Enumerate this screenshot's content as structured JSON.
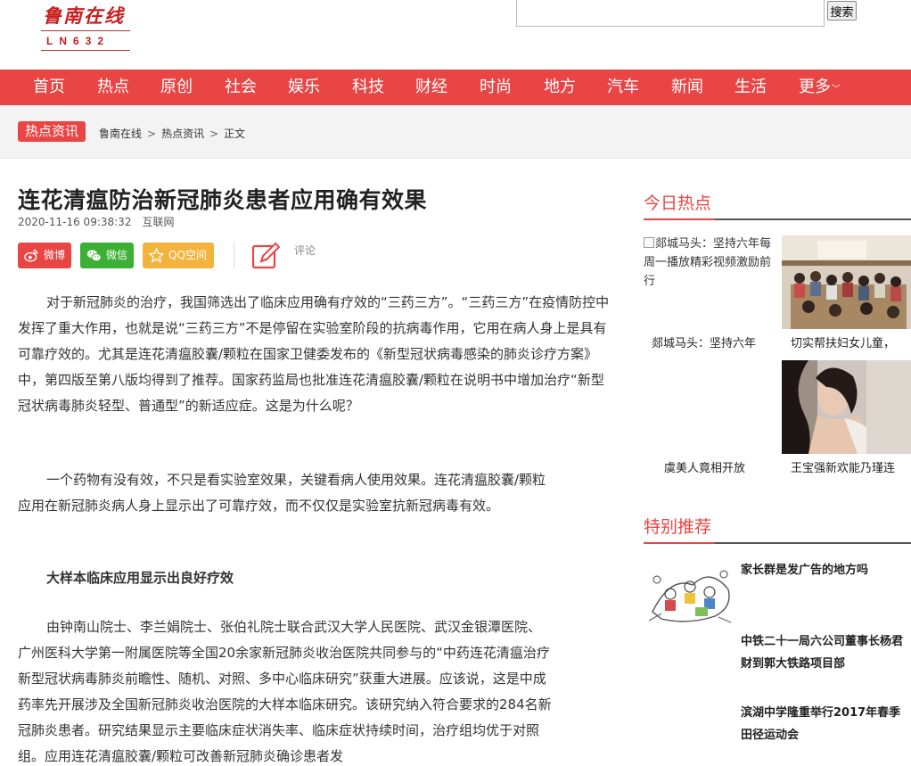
{
  "site": {
    "logo_cn": "鲁南在线",
    "logo_en": "LN632"
  },
  "search": {
    "value": "",
    "button_label": "搜索"
  },
  "nav": [
    {
      "label": "首页"
    },
    {
      "label": "热点"
    },
    {
      "label": "原创"
    },
    {
      "label": "社会"
    },
    {
      "label": "娱乐"
    },
    {
      "label": "科技"
    },
    {
      "label": "财经"
    },
    {
      "label": "时尚"
    },
    {
      "label": "地方"
    },
    {
      "label": "汽车"
    },
    {
      "label": "新闻"
    },
    {
      "label": "生活"
    },
    {
      "label": "更多"
    }
  ],
  "breadcrumb": {
    "badge": "热点资讯",
    "items": [
      "鲁南在线",
      "热点资讯",
      "正文"
    ],
    "sep": ">"
  },
  "article": {
    "title": "连花清瘟防治新冠肺炎患者应用确有效果",
    "date": "2020-11-16 09:38:32",
    "source": "互联网",
    "share": {
      "weibo": "微博",
      "wechat": "微信",
      "qzone": "QQ空间",
      "comment": "评论"
    },
    "colors": {
      "weibo": "#e94545",
      "wechat": "#3cb034",
      "qzone": "#f4b33d"
    },
    "paragraphs": [
      "对于新冠肺炎的治疗，我国筛选出了临床应用确有疗效的“三药三方”。“三药三方”在疫情防控中发挥了重大作用，也就是说“三药三方”不是停留在实验室阶段的抗病毒作用，它用在病人身上是具有可靠疗效的。尤其是连花清瘟胶囊/颗粒在国家卫健委发布的《新型冠状病毒感染的肺炎诊疗方案》中，第四版至第八版均得到了推荐。国家药监局也批准连花清瘟胶囊/颗粒在说明书中增加治疗“新型冠状病毒肺炎轻型、普通型”的新适应症。这是为什么呢？",
      "一个药物有没有效，不只是看实验室效果，关键看病人使用效果。连花清瘟胶囊/颗粒应用在新冠肺炎病人身上显示出了可靠疗效，而不仅仅是实验室抗新冠病毒有效。",
      "大样本临床应用显示出良好疗效",
      "由钟南山院士、李兰娟院士、张伯礼院士联合武汉大学人民医院、武汉金银潭医院、广州医科大学第一附属医院等全国20余家新冠肺炎收治医院共同参与的“中药连花清瘟治疗新型冠状病毒肺炎前瞻性、随机、对照、多中心临床研究”获重大进展。应该说，这是中成药率先开展涉及全国新冠肺炎收治医院的大样本临床研究。该研究纳入符合要求的284名新冠肺炎患者。研究结果显示主要临床症状消失率、临床症状持续时间，治疗组均优于对照组。应用连花清瘟胶囊/颗粒可改善新冠肺炎确诊患者发"
    ]
  },
  "sidebar": {
    "hot_title": "今日热点",
    "hot": [
      {
        "alt": "郯城马头：坚持六年每周一播放精彩视频激励前行",
        "caption": "郯城马头：坚持六年"
      },
      {
        "caption": "切实帮扶妇女儿童，"
      },
      {
        "caption": "虞美人竟相开放"
      },
      {
        "caption": "王宝强新欢能乃瑾连"
      }
    ],
    "rec_title": "特别推荐",
    "rec": [
      {
        "title": "家长群是发广告的地方吗"
      },
      {
        "title": "中铁二十一局六公司董事长杨君财到郭大铁路项目部"
      },
      {
        "title": "滨湖中学隆重举行2017年春季田径运动会"
      }
    ]
  }
}
